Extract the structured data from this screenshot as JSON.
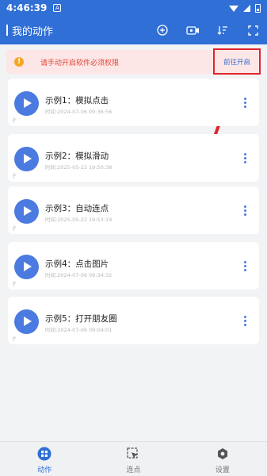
{
  "status": {
    "time": "4:46:39",
    "notif": "A"
  },
  "appbar": {
    "title": "我的动作",
    "actions": [
      "add-icon",
      "record-icon",
      "sort-icon",
      "scan-icon"
    ]
  },
  "banner": {
    "message": "请手动开启软件必须权限",
    "button": "前往开启",
    "warn_glyph": "!"
  },
  "scripts": [
    {
      "name": "示例1：模拟点击",
      "time": "时间:2024-07-06 09:36:56"
    },
    {
      "name": "示例2：模拟滑动",
      "time": "时间:2025-05-22 19:50:38"
    },
    {
      "name": "示例3：自动连点",
      "time": "时间:2025-05-22 19:53:19"
    },
    {
      "name": "示例4：点击图片",
      "time": "时间:2024-07-06 09:34:32"
    },
    {
      "name": "示例5：打开朋友圈",
      "time": "时间:2024-07-06 09:04:01"
    }
  ],
  "tabs": [
    {
      "label": "动作",
      "icon": "grid-icon",
      "active": true
    },
    {
      "label": "连点",
      "icon": "cursor-icon",
      "active": false
    },
    {
      "label": "设置",
      "icon": "gear-icon",
      "active": false
    }
  ],
  "colors": {
    "primary": "#2f6fd6",
    "play": "#4b7be0",
    "warning": "#e0483a",
    "highlight": "#e0242b"
  }
}
